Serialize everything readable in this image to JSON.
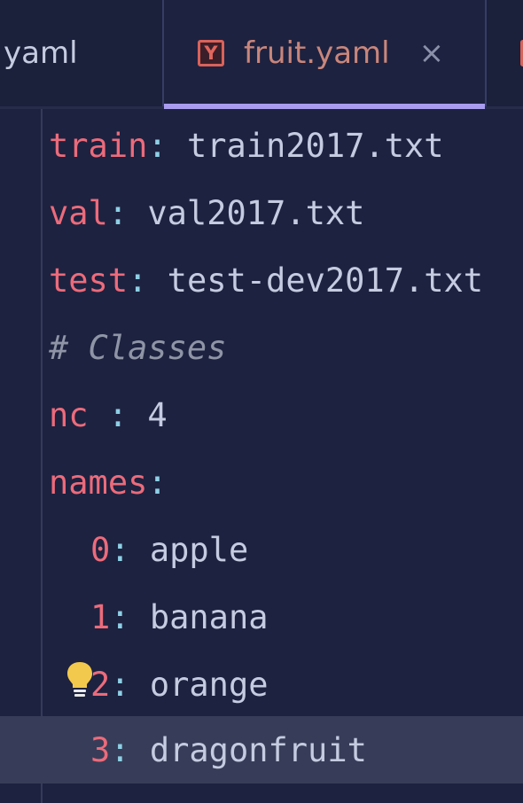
{
  "tabs": [
    {
      "label": "yaml",
      "active": false
    },
    {
      "label": "fruit.yaml",
      "active": true,
      "icon": "yaml-file-icon",
      "icon_letter": "Y"
    },
    {
      "label": "",
      "active": false,
      "icon": "yaml-file-icon"
    }
  ],
  "colors": {
    "background": "#1d2240",
    "key": "#ec6b7b",
    "punctuation": "#8ed0e6",
    "value": "#c5cbe0",
    "comment": "#8f95a6",
    "active_tab_underline": "#a99cf0",
    "current_line": "#373d58"
  },
  "editor": {
    "lines": [
      {
        "key": "train",
        "sep": ":",
        "value": " train2017.txt"
      },
      {
        "key": "val",
        "sep": ":",
        "value": " val2017.txt"
      },
      {
        "key": "test",
        "sep": ":",
        "value": " test-dev2017.txt"
      },
      {
        "comment": "# Classes"
      },
      {
        "key": "nc ",
        "sep": ":",
        "value": " 4"
      },
      {
        "key": "names",
        "sep": ":",
        "value": ""
      },
      {
        "key": "0",
        "sep": ":",
        "value": " apple"
      },
      {
        "key": "1",
        "sep": ":",
        "value": " banana"
      },
      {
        "key": "2",
        "sep": ":",
        "value": " orange"
      },
      {
        "key": "3",
        "sep": ":",
        "value": " dragonfruit"
      }
    ],
    "current_line": 10,
    "intention_icon": "lightbulb-icon"
  }
}
